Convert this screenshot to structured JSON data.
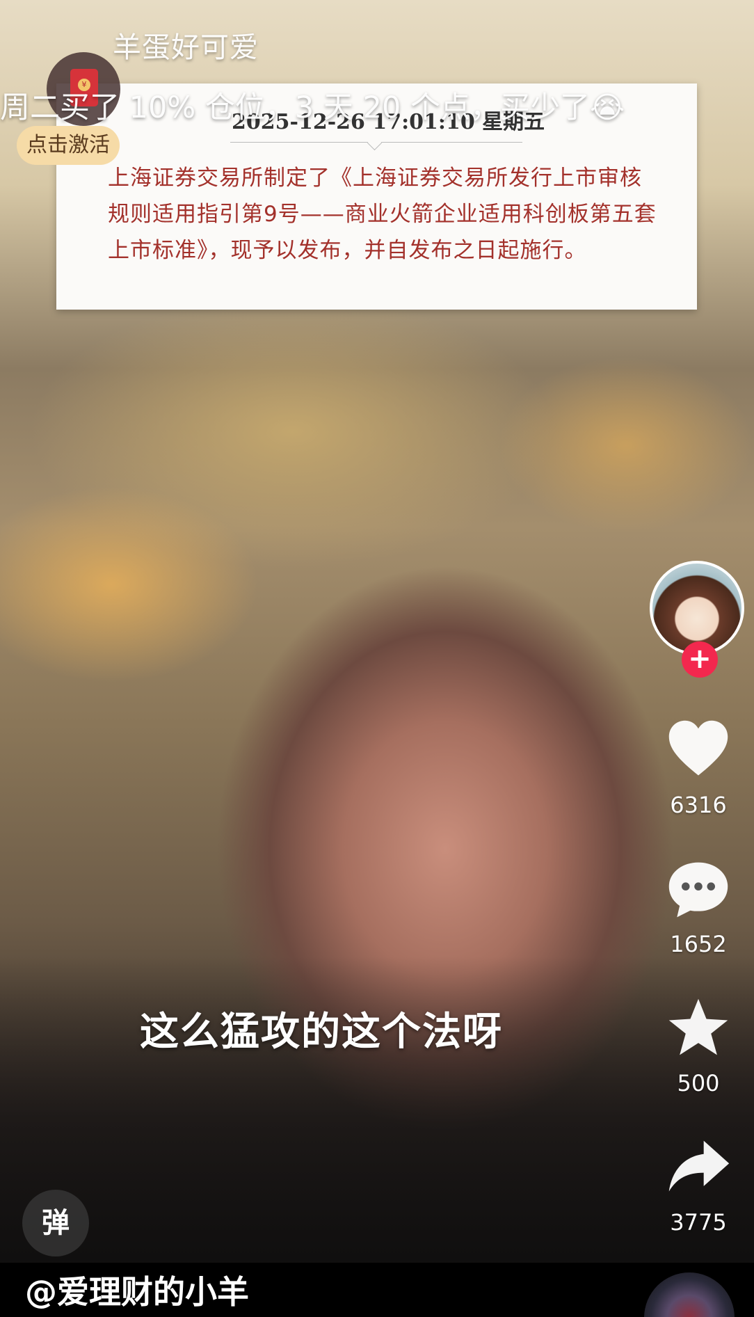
{
  "top": {
    "title": "羊蛋好可爱",
    "caption": "周二买了 10% 仓位，3 天 20 个点，买少了😭"
  },
  "news_card": {
    "date": "2025-12-26 17:01:10 星期五",
    "body": "上海证券交易所制定了《上海证券交易所发行上市审核规则适用指引第9号——商业火箭企业适用科创板第五套上市标准》，现予以发布，并自发布之日起施行。"
  },
  "red_packet": {
    "coin_symbol": "¥",
    "activate_label": "点击激活"
  },
  "subtitle": "这么猛攻的这个法呀",
  "rail": {
    "follow_symbol": "+",
    "like_count": "6316",
    "comment_count": "1652",
    "favorite_count": "500",
    "share_count": "3775"
  },
  "danmu_label": "弹",
  "author": "@爱理财的小羊",
  "colors": {
    "follow": "#f3284e",
    "news_text": "#a3312b",
    "activate_bg": "#f6dba7"
  }
}
